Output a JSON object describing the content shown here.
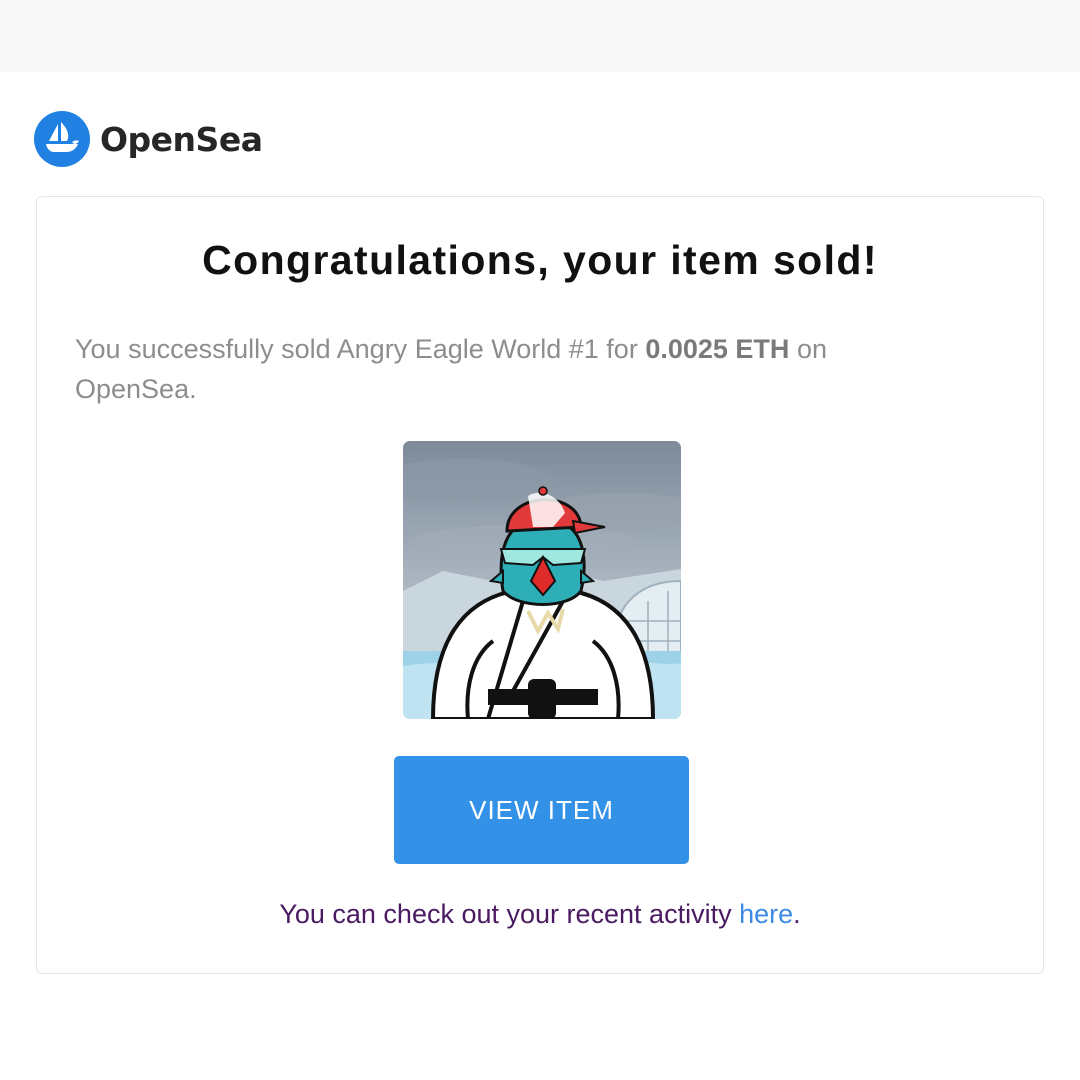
{
  "brand": {
    "name": "OpenSea",
    "logo_icon": "opensea-boat-icon",
    "logo_color": "#2081e2"
  },
  "email": {
    "headline": "Congratulations, your item sold!",
    "message": {
      "prefix": "You successfully sold Angry Eagle World #1 for",
      "price": "0.0025 ETH",
      "suffix": "on OpenSea."
    },
    "item_image_alt": "Angry Eagle World #1",
    "button_label": "VIEW ITEM",
    "activity": {
      "text": "You can check out your recent activity",
      "link_label": "here",
      "end": "."
    }
  },
  "colors": {
    "button": "#3391e8",
    "link": "#3d8be6",
    "activity_text": "#4a1a62",
    "message_text": "#8d8d8d"
  }
}
